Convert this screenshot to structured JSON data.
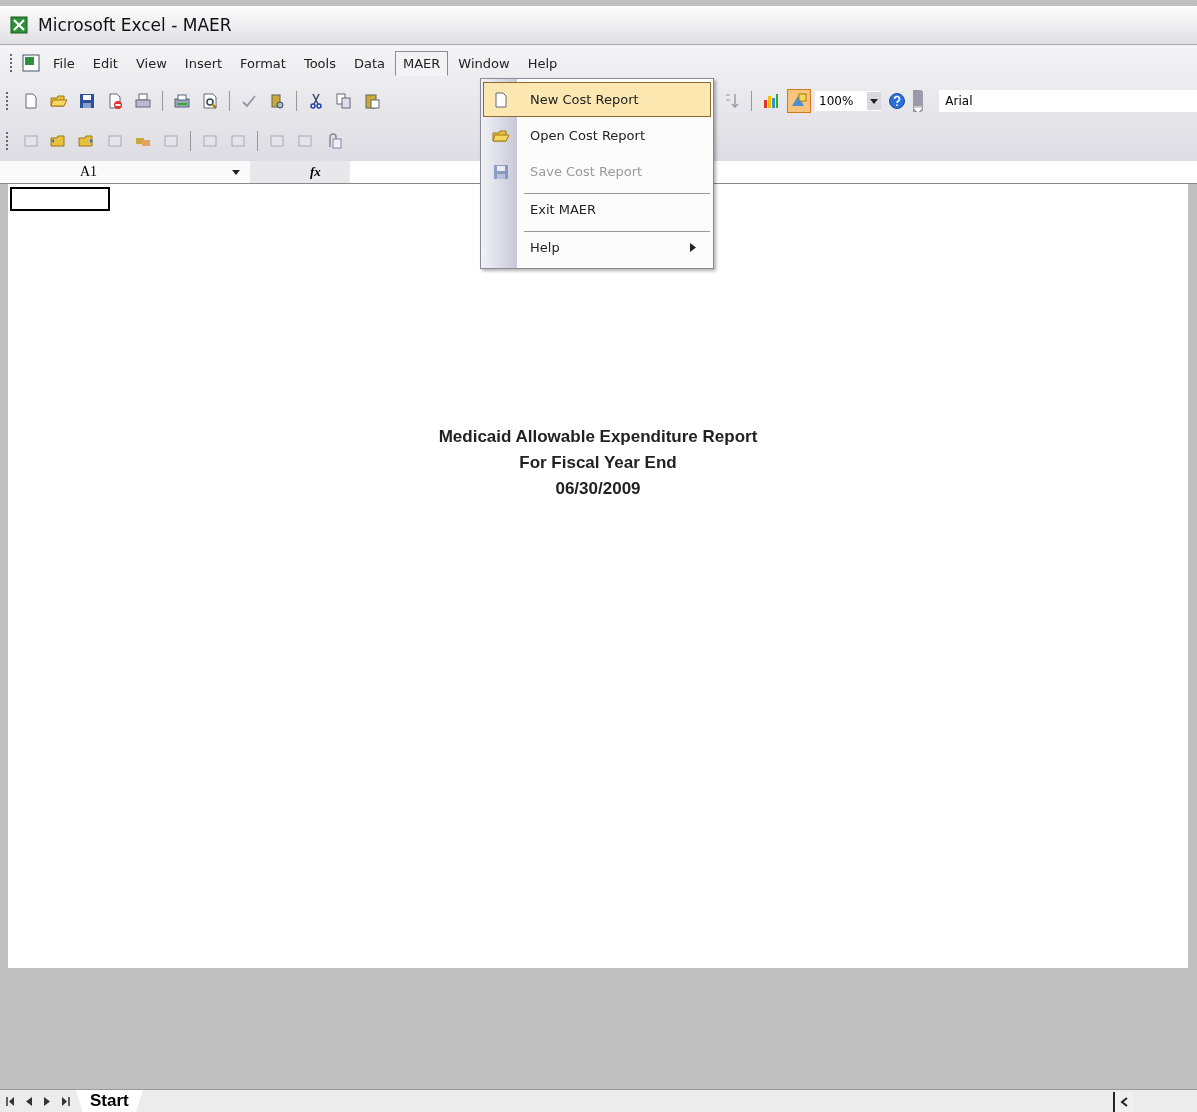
{
  "window": {
    "title": "Microsoft Excel - MAER"
  },
  "menu_bar": [
    {
      "label": "File",
      "selected": false
    },
    {
      "label": "Edit",
      "selected": false
    },
    {
      "label": "View",
      "selected": false
    },
    {
      "label": "Insert",
      "selected": false
    },
    {
      "label": "Format",
      "selected": false
    },
    {
      "label": "Tools",
      "selected": false
    },
    {
      "label": "Data",
      "selected": false
    },
    {
      "label": "MAER",
      "selected": true
    },
    {
      "label": "Window",
      "selected": false
    },
    {
      "label": "Help",
      "selected": false
    }
  ],
  "dropdown": [
    {
      "label": "New Cost Report",
      "selected": true,
      "disabled": false,
      "separator_before": false,
      "submenu": false
    },
    {
      "label": "Open Cost Report",
      "selected": false,
      "disabled": false,
      "separator_before": false,
      "submenu": false
    },
    {
      "label": "Save Cost Report",
      "selected": false,
      "disabled": true,
      "separator_before": false,
      "submenu": false
    },
    {
      "label": "Exit MAER",
      "selected": false,
      "disabled": false,
      "separator_before": true,
      "submenu": false
    },
    {
      "label": "Help",
      "selected": false,
      "disabled": false,
      "separator_before": true,
      "submenu": true
    }
  ],
  "toolbar": {
    "zoom": "100%",
    "font": "Arial",
    "drawing_on": true
  },
  "formula_bar": {
    "name_box": "A1",
    "fx": "fx"
  },
  "sheet": {
    "lines": [
      "Medicaid Allowable Expenditure Report",
      "For Fiscal Year End",
      "06/30/2009"
    ]
  },
  "sheet_tabs": [
    {
      "label": "Start",
      "selected": true
    }
  ]
}
